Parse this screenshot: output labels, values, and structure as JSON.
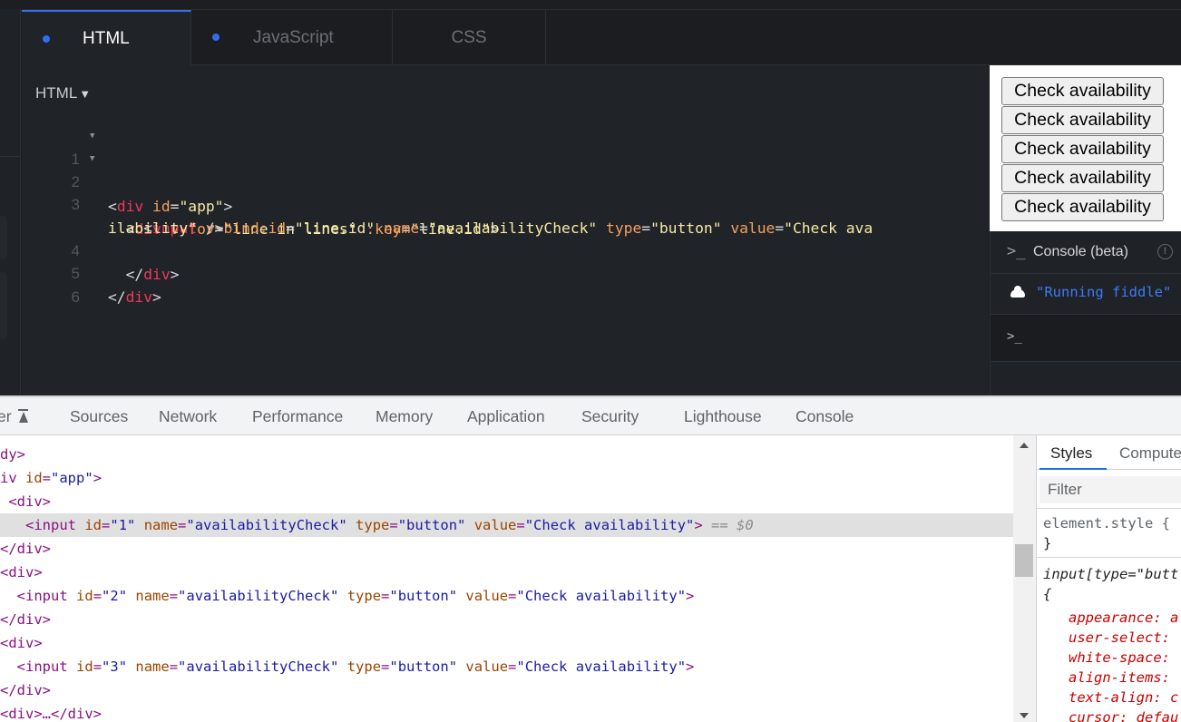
{
  "editor": {
    "tabs": [
      {
        "label": "HTML",
        "active": true,
        "modified": true
      },
      {
        "label": "JavaScript",
        "active": false,
        "modified": true
      },
      {
        "label": "CSS",
        "active": false,
        "modified": false
      }
    ],
    "language_select": "HTML",
    "code_lines": [
      {
        "num": "1",
        "foldable": true
      },
      {
        "num": "2",
        "foldable": true
      },
      {
        "num": "3",
        "foldable": false
      },
      {
        "num": "",
        "foldable": false
      },
      {
        "num": "4",
        "foldable": false
      },
      {
        "num": "5",
        "foldable": false
      },
      {
        "num": "6",
        "foldable": false
      }
    ],
    "code": {
      "l1": {
        "open": "<",
        "tag": "div",
        "attr": "id",
        "eq": "=",
        "val": "\"app\"",
        "close": ">"
      },
      "l2": {
        "open": "<",
        "tag": "div",
        "a1": "v-for",
        "v1": "\"line in lines\"",
        "a2": ":key",
        "v2": "\"line.id\"",
        "close": ">"
      },
      "l3": {
        "open": "<",
        "tag": "input",
        "a1": "v-bind:id",
        "v1": "\"line.id\"",
        "a2": "name",
        "v2": "\"availabilityCheck\"",
        "a3": "type",
        "v3": "\"button\"",
        "a4": "value",
        "v4a": "\"Check ava"
      },
      "l3b": {
        "v4b": "ilability\"",
        "close": " />"
      },
      "l4": {
        "open": "</",
        "tag": "div",
        "close": ">"
      },
      "l5": {
        "open": "</",
        "tag": "div",
        "close": ">"
      }
    }
  },
  "result": {
    "buttons": [
      "Check availability",
      "Check availability",
      "Check availability",
      "Check availability",
      "Check availability"
    ]
  },
  "console": {
    "prompt_icon": ">_",
    "title": "Console (beta)",
    "info_icon": "!",
    "message": "\"Running fiddle\"",
    "input_prompt": ">_"
  },
  "devtools": {
    "tabs": [
      "er",
      "Sources",
      "Network",
      "Performance",
      "Memory",
      "Application",
      "Security",
      "Lighthouse",
      "Console"
    ],
    "dom": {
      "r0": "dy>",
      "r1": {
        "pre": "iv ",
        "attr": "id",
        "val": "\"app\"",
        "close": ">"
      },
      "r2": "<div>",
      "inputs": [
        {
          "id": "\"1\"",
          "name": "\"availabilityCheck\"",
          "type": "\"button\"",
          "value": "\"Check availability\""
        },
        {
          "id": "\"2\"",
          "name": "\"availabilityCheck\"",
          "type": "\"button\"",
          "value": "\"Check availability\""
        },
        {
          "id": "\"3\"",
          "name": "\"availabilityCheck\"",
          "type": "\"button\"",
          "value": "\"Check availability\""
        }
      ],
      "selected_marker": "== $0",
      "close_div": "</div>",
      "open_div": "<div>",
      "collapsed_div": "<div>…</div>",
      "attr_id": "id",
      "attr_name": "name",
      "attr_type": "type",
      "attr_value": "value",
      "input_open": "<input",
      "tag_close": ">"
    },
    "styles": {
      "tabs": [
        "Styles",
        "Compute"
      ],
      "filter_placeholder": "Filter",
      "element_style": "element.style {",
      "close_brace": "}",
      "rule_selector": "input[type=\"butt",
      "open_brace": "{",
      "props": [
        "appearance: a",
        "user-select:",
        "white-space:",
        "align-items:",
        "text-align: c",
        "cursor: defau"
      ]
    }
  }
}
